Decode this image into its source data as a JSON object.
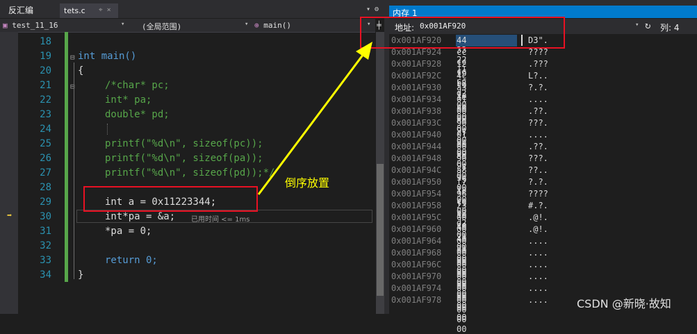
{
  "tabs": {
    "disassembly": "反汇编",
    "file": "tets.c",
    "file_icons": "⌖ ×",
    "memory": "内存 1",
    "memory_tab_icons": "▾ ⚙"
  },
  "nav": {
    "project": "test_11_16",
    "scope": "(全局范围)",
    "function": "main()"
  },
  "memory_toolbar": {
    "address_label": "地址:",
    "address_value": "0x001AF920",
    "column_label": "列: 4"
  },
  "code_lines": [
    {
      "num": "18",
      "text": ""
    },
    {
      "num": "19",
      "text": "int main()"
    },
    {
      "num": "20",
      "text": "{"
    },
    {
      "num": "21",
      "text": "/*char* pc;"
    },
    {
      "num": "22",
      "text": "int* pa;"
    },
    {
      "num": "23",
      "text": "double* pd;"
    },
    {
      "num": "24",
      "text": ""
    },
    {
      "num": "25",
      "text": "printf(\"%d\\n\", sizeof(pc));"
    },
    {
      "num": "26",
      "text": "printf(\"%d\\n\", sizeof(pa));"
    },
    {
      "num": "27",
      "text": "printf(\"%d\\n\", sizeof(pd));*/"
    },
    {
      "num": "28",
      "text": ""
    },
    {
      "num": "29",
      "text": "int a = 0x11223344;"
    },
    {
      "num": "30",
      "text": "int*pa = &a;"
    },
    {
      "num": "31",
      "text": "*pa = 0;"
    },
    {
      "num": "32",
      "text": ""
    },
    {
      "num": "33",
      "text": "return 0;"
    },
    {
      "num": "34",
      "text": "}"
    }
  ],
  "perf_hint": "已用时间 <= 1ms",
  "memory_rows": [
    {
      "addr": "0x001AF920",
      "bytes": "44 33 22 11",
      "ascii": "D3\"."
    },
    {
      "addr": "0x001AF924",
      "bytes": "cc cc cc cc",
      "ascii": "????"
    },
    {
      "addr": "0x001AF928",
      "bytes": "12 f9 b2 d2",
      "ascii": ".???"
    },
    {
      "addr": "0x001AF92C",
      "bytes": "4c f9 1a 00",
      "ascii": "L?.."
    },
    {
      "addr": "0x001AF930",
      "bytes": "a3 1e ce 00",
      "ascii": "?.?."
    },
    {
      "addr": "0x001AF934",
      "bytes": "01 00 00 00",
      "ascii": "...."
    },
    {
      "addr": "0x001AF938",
      "bytes": "00 8d 9c 00",
      "ascii": ".??."
    },
    {
      "addr": "0x001AF93C",
      "bytes": "90 c7 9c 00",
      "ascii": "???."
    },
    {
      "addr": "0x001AF940",
      "bytes": "01 00 00 00",
      "ascii": "...."
    },
    {
      "addr": "0x001AF944",
      "bytes": "00 8d 9c 00",
      "ascii": ".??."
    },
    {
      "addr": "0x001AF948",
      "bytes": "90 c7 9c 00",
      "ascii": "???."
    },
    {
      "addr": "0x001AF94C",
      "bytes": "a8 f9 1a 00",
      "ascii": "??.."
    },
    {
      "addr": "0x001AF950",
      "bytes": "f7 1c ce 00",
      "ascii": "?.?."
    },
    {
      "addr": "0x001AF954",
      "bytes": "96 f9 b2 d2",
      "ascii": "????"
    },
    {
      "addr": "0x001AF958",
      "bytes": "23 10 ce 00",
      "ascii": "#.?."
    },
    {
      "addr": "0x001AF95C",
      "bytes": "00 40 21 00",
      "ascii": ".@!."
    },
    {
      "addr": "0x001AF960",
      "bytes": "00 40 21 00",
      "ascii": ".@!."
    },
    {
      "addr": "0x001AF964",
      "bytes": "00 00 00 00",
      "ascii": "...."
    },
    {
      "addr": "0x001AF968",
      "bytes": "00 00 00 00",
      "ascii": "...."
    },
    {
      "addr": "0x001AF96C",
      "bytes": "00 00 00 00",
      "ascii": "...."
    },
    {
      "addr": "0x001AF970",
      "bytes": "00 00 00 00",
      "ascii": "...."
    },
    {
      "addr": "0x001AF974",
      "bytes": "00 00 00 00",
      "ascii": "...."
    },
    {
      "addr": "0x001AF978",
      "bytes": "00 00 00 00",
      "ascii": "...."
    }
  ],
  "annotation": "倒序放置",
  "watermark": "CSDN @新晓·故知",
  "colors": {
    "accent": "#007acc",
    "annotation_box": "#e81123",
    "annotation_arrow": "#ffff00",
    "change_bar": "#57a64a"
  },
  "icons": {
    "exec_pointer": "arrow-right-icon",
    "refresh": "refresh-icon"
  }
}
